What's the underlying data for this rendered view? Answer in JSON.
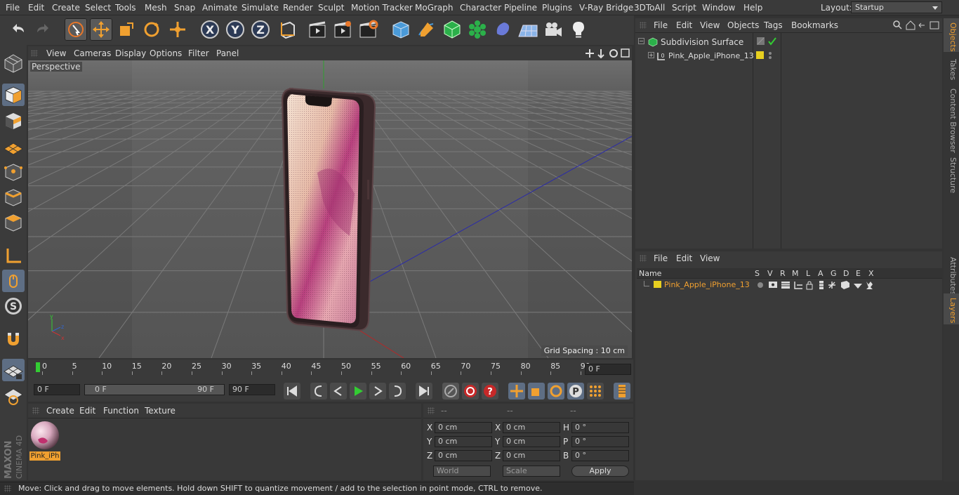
{
  "menubar": {
    "items": [
      "File",
      "Edit",
      "Create",
      "Select",
      "Tools",
      "Mesh",
      "Snap",
      "Animate",
      "Simulate",
      "Render",
      "Sculpt",
      "Motion Tracker",
      "MoGraph",
      "Character",
      "Pipeline",
      "Plugins",
      "V-Ray Bridge",
      "3DToAll",
      "Script",
      "Window",
      "Help"
    ],
    "layout_label": "Layout:",
    "layout_value": "Startup"
  },
  "viewport": {
    "menu": [
      "View",
      "Cameras",
      "Display",
      "Options",
      "Filter",
      "Panel"
    ],
    "name": "Perspective",
    "grid_spacing": "Grid Spacing : 10 cm"
  },
  "timeline": {
    "ticks": [
      "0",
      "5",
      "10",
      "15",
      "20",
      "25",
      "30",
      "35",
      "40",
      "45",
      "50",
      "55",
      "60",
      "65",
      "70",
      "75",
      "80",
      "85",
      "90"
    ],
    "current_frame": "0 F",
    "start_field": "0 F",
    "range_start": "0 F",
    "range_end": "90 F",
    "end_field": "90 F"
  },
  "material_panel": {
    "menu": [
      "Create",
      "Edit",
      "Function",
      "Texture"
    ],
    "material_name": "Pink_iPh"
  },
  "coords": {
    "headers": [
      "--",
      "--",
      "--"
    ],
    "rows": [
      {
        "a": "X",
        "av": "0 cm",
        "b": "X",
        "bv": "0 cm",
        "c": "H",
        "cv": "0 °"
      },
      {
        "a": "Y",
        "av": "0 cm",
        "b": "Y",
        "bv": "0 cm",
        "c": "P",
        "cv": "0 °"
      },
      {
        "a": "Z",
        "av": "0 cm",
        "b": "Z",
        "bv": "0 cm",
        "c": "B",
        "cv": "0 °"
      }
    ],
    "world": "World",
    "scale": "Scale",
    "apply": "Apply"
  },
  "objects": {
    "menu": [
      "File",
      "Edit",
      "View",
      "Objects",
      "Tags",
      "Bookmarks"
    ],
    "items": [
      "Subdivision Surface",
      "Pink_Apple_iPhone_13"
    ]
  },
  "layers": {
    "menu": [
      "File",
      "Edit",
      "View"
    ],
    "name_col": "Name",
    "cols": [
      "S",
      "V",
      "R",
      "M",
      "L",
      "A",
      "G",
      "D",
      "E",
      "X"
    ],
    "layer_name": "Pink_Apple_iPhone_13"
  },
  "sidetabs": [
    "Objects",
    "Takes",
    "Content Browser",
    "Structure",
    "Attributes",
    "Layers"
  ],
  "status": "Move: Click and drag to move elements. Hold down SHIFT to quantize movement / add to the selection in point mode, CTRL to remove.",
  "brand": "MAXON CINEMA 4D",
  "colors": {
    "accent": "#f0a030",
    "selection": "#5e6e84",
    "layer_yellow": "#e8d020"
  }
}
